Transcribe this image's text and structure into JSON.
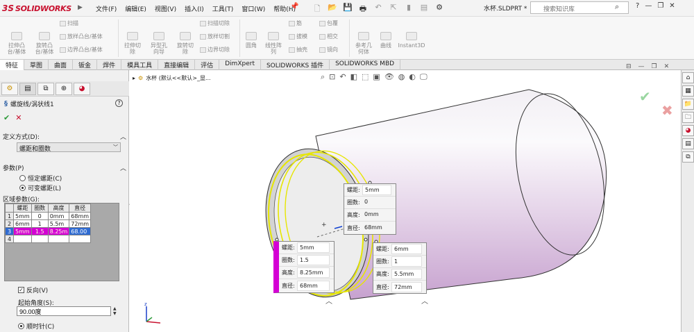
{
  "app": {
    "logo_ds": "3S",
    "logo_text": "SOLIDWORKS",
    "document_title": "水杯.SLDPRT *",
    "search_placeholder": "搜索知识库"
  },
  "menu": [
    "文件(F)",
    "编辑(E)",
    "视图(V)",
    "插入(I)",
    "工具(T)",
    "窗口(W)",
    "帮助(H)"
  ],
  "ribbon": {
    "large": [
      {
        "label": "拉伸凸\n台/基体"
      },
      {
        "label": "旋转凸\n台/基体"
      },
      {
        "label": "拉伸切\n除"
      },
      {
        "label": "异型孔\n向导"
      },
      {
        "label": "旋转切\n除"
      },
      {
        "label": "线性阵\n列"
      },
      {
        "label": "参考几\n何体"
      },
      {
        "label": "曲线"
      },
      {
        "label": "Instant3D"
      }
    ],
    "small": [
      "扫描",
      "放样凸台/基体",
      "边界凸台/基体",
      "扫描切除",
      "放样切割",
      "边界切除",
      "圆角",
      "筋",
      "拔模",
      "抽壳",
      "包覆",
      "相交",
      "镜向"
    ]
  },
  "tabs": [
    "特征",
    "草图",
    "曲面",
    "钣金",
    "焊件",
    "模具工具",
    "直接编辑",
    "评估",
    "DimXpert",
    "SOLIDWORKS 插件",
    "SOLIDWORKS MBD"
  ],
  "feature": {
    "title": "螺旋线/涡状线1",
    "definition_group": "定义方式(D):",
    "definition_value": "螺距和圈数",
    "params_group": "参数(P)",
    "radio_constant": "恒定螺距(C)",
    "radio_variable": "可变螺距(L)",
    "region_label": "区域参数(G):",
    "grid_headers": [
      "螺距",
      "圈数",
      "高度",
      "直径"
    ],
    "grid_rows": [
      {
        "n": "1",
        "cells": [
          "5mm",
          "0",
          "0mm",
          "68mm"
        ]
      },
      {
        "n": "2",
        "cells": [
          "6mm",
          "1",
          "5.5m",
          "72mm"
        ]
      },
      {
        "n": "3",
        "cells": [
          "5mm",
          "1.5",
          "8.25m",
          "68.00"
        ]
      },
      {
        "n": "4",
        "cells": [
          "",
          "",
          "",
          ""
        ]
      }
    ],
    "reverse_label": "反向(V)",
    "start_angle_label": "起始角度(S):",
    "start_angle_value": "90.00度",
    "clockwise_label": "顺时针(C)"
  },
  "viewport": {
    "breadcrumb": "水杯  (默认<<默认>_显..."
  },
  "callouts": [
    {
      "rows": [
        {
          "lab": "螺距:",
          "val": "5mm"
        },
        {
          "lab": "圈数:",
          "val": "0"
        },
        {
          "lab": "高度:",
          "val": "0mm"
        },
        {
          "lab": "直径:",
          "val": "68mm"
        }
      ]
    },
    {
      "rows": [
        {
          "lab": "螺距:",
          "val": "5mm"
        },
        {
          "lab": "圈数:",
          "val": "1.5"
        },
        {
          "lab": "高度:",
          "val": "8.25mm"
        },
        {
          "lab": "直径:",
          "val": "68mm"
        }
      ]
    },
    {
      "rows": [
        {
          "lab": "螺距:",
          "val": "6mm"
        },
        {
          "lab": "圈数:",
          "val": "1"
        },
        {
          "lab": "高度:",
          "val": "5.5mm"
        },
        {
          "lab": "直径:",
          "val": "72mm"
        }
      ]
    }
  ],
  "colors": {
    "accent_magenta": "#d400d4",
    "brand_red": "#c8102e",
    "helix_yellow": "#e6e600",
    "selection_blue": "#2f6bd1"
  }
}
